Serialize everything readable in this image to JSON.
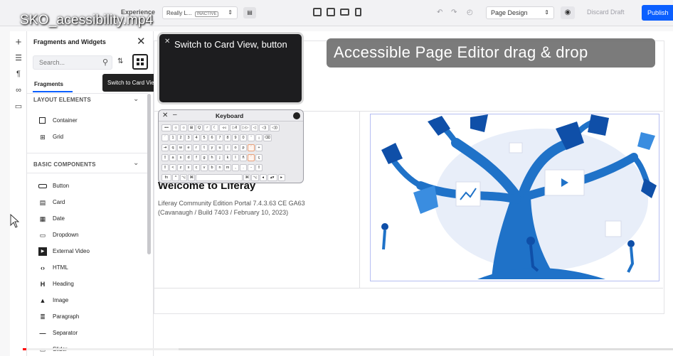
{
  "video": {
    "title": "SKO_acessibility.mp4",
    "progress_played": 0.006,
    "progress_loaded": 0.24
  },
  "topbar": {
    "experience_label": "Experience",
    "experience_value": "Really L...",
    "experience_badge": "INACTIVE",
    "mode_value": "Page Design",
    "discard_label": "Discard Draft",
    "publish_label": "Publish"
  },
  "sidebar": {
    "title": "Fragments and Widgets",
    "search_placeholder": "Search...",
    "tab_fragments": "Fragments",
    "tooltip": "Switch to Card View",
    "sections": [
      {
        "label": "LAYOUT ELEMENTS",
        "items": [
          {
            "label": "Container",
            "icon": "container-icon"
          },
          {
            "label": "Grid",
            "icon": "grid-icon"
          }
        ]
      },
      {
        "label": "BASIC COMPONENTS",
        "items": [
          {
            "label": "Button",
            "icon": "button-icon"
          },
          {
            "label": "Card",
            "icon": "card-icon"
          },
          {
            "label": "Date",
            "icon": "date-icon"
          },
          {
            "label": "Dropdown",
            "icon": "dropdown-icon"
          },
          {
            "label": "External Video",
            "icon": "video-icon"
          },
          {
            "label": "HTML",
            "icon": "code-icon"
          },
          {
            "label": "Heading",
            "icon": "heading-icon"
          },
          {
            "label": "Image",
            "icon": "image-icon"
          },
          {
            "label": "Paragraph",
            "icon": "paragraph-icon"
          },
          {
            "label": "Separator",
            "icon": "separator-icon"
          },
          {
            "label": "Slider",
            "icon": "slider-icon"
          }
        ]
      }
    ]
  },
  "speech": {
    "text": "Switch to Card View, button"
  },
  "keyboard": {
    "title": "Keyboard",
    "rows": [
      [
        "•••",
        "☼",
        "☼",
        "⊞",
        "Q",
        "♂",
        "☾",
        "◃◃",
        "▷‖",
        "▷▷",
        "◁",
        "◁)",
        "◁))"
      ],
      [
        "´",
        "1",
        "2",
        "3",
        "4",
        "5",
        "6",
        "7",
        "8",
        "9",
        "0",
        "'",
        "¡",
        "⌫"
      ],
      [
        "⇥",
        "q",
        "w",
        "e",
        "r",
        "t",
        "y",
        "u",
        "i",
        "o",
        "p",
        "´",
        "+"
      ],
      [
        "⇪",
        "a",
        "s",
        "d",
        "f",
        "g",
        "h",
        "j",
        "k",
        "l",
        "ñ",
        "´",
        "ç"
      ],
      [
        "⇧",
        "<",
        "z",
        "x",
        "c",
        "v",
        "b",
        "n",
        "m",
        ",",
        ".",
        "-",
        "⇧"
      ],
      [
        "fn",
        "^",
        "⌥",
        "⌘",
        "",
        "⌘",
        "⌥",
        "◂",
        "▴▾",
        "▸"
      ]
    ]
  },
  "banner": {
    "text": "Accessible Page Editor drag & drop"
  },
  "content": {
    "welcome": "Welcome to Liferay",
    "version_line": "Liferay Community Edition Portal 7.4.3.63 CE GA63",
    "build_line": "(Cavanaugh / Build 7403 / February 10, 2023)"
  },
  "colors": {
    "accent": "#0b5fff",
    "tree_blue": "#1f72c8",
    "tree_dark": "#0f4fa8",
    "progress": "#ff0000"
  }
}
